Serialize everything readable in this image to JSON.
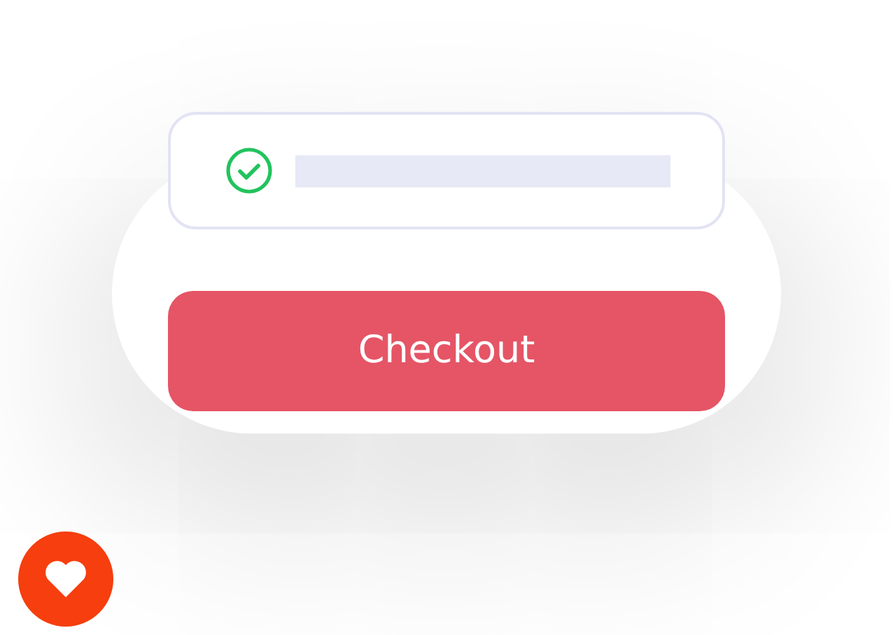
{
  "checkout_button": {
    "label": "Checkout"
  }
}
